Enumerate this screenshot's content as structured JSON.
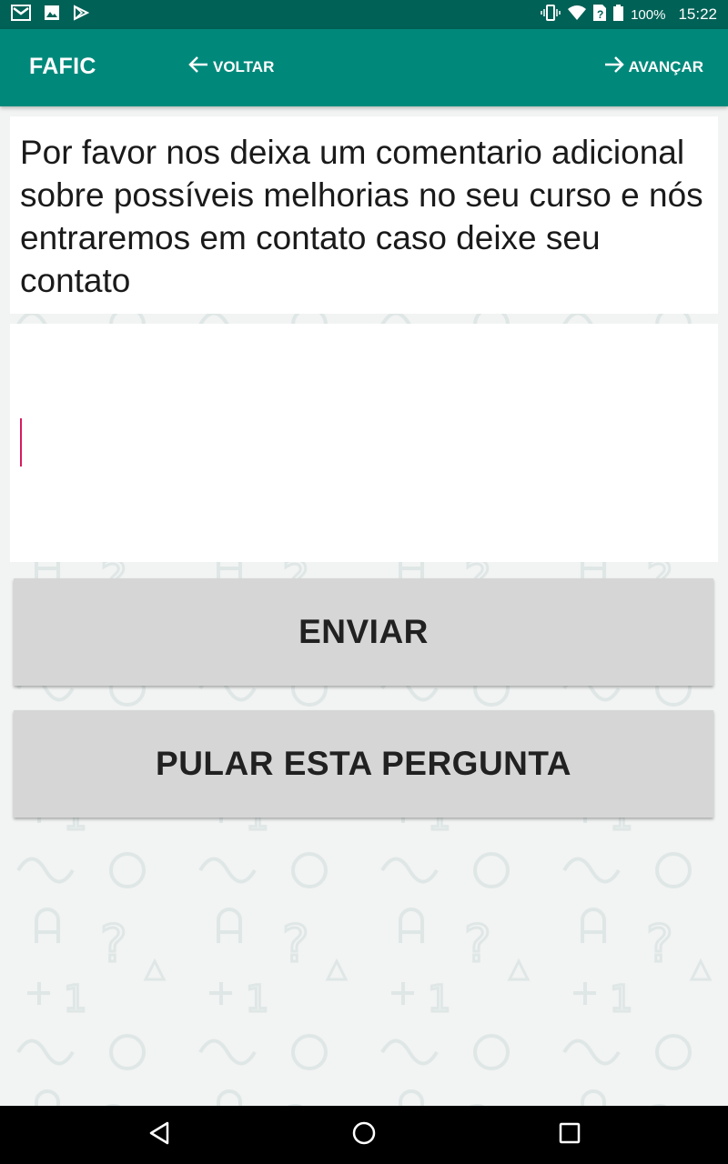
{
  "status_bar": {
    "battery": "100%",
    "time": "15:22",
    "icons": [
      "gmail-icon",
      "image-icon",
      "play-store-icon",
      "vibrate-icon",
      "wifi-icon",
      "no-sim-icon",
      "battery-icon"
    ]
  },
  "app_bar": {
    "title": "FAFIC",
    "back_label": "VOLTAR",
    "forward_label": "AVANÇAR",
    "color": "#00897b"
  },
  "question": {
    "text": "Por favor nos deixa um comentario adicional sobre possíveis melhorias no seu curso e nós entraremos em contato caso deixe seu contato"
  },
  "answer": {
    "value": "",
    "placeholder": ""
  },
  "buttons": {
    "send_label": "ENVIAR",
    "skip_label": "PULAR ESTA PERGUNTA"
  },
  "nav_bar": {
    "icons": [
      "back-triangle-icon",
      "home-circle-icon",
      "recents-square-icon"
    ]
  }
}
